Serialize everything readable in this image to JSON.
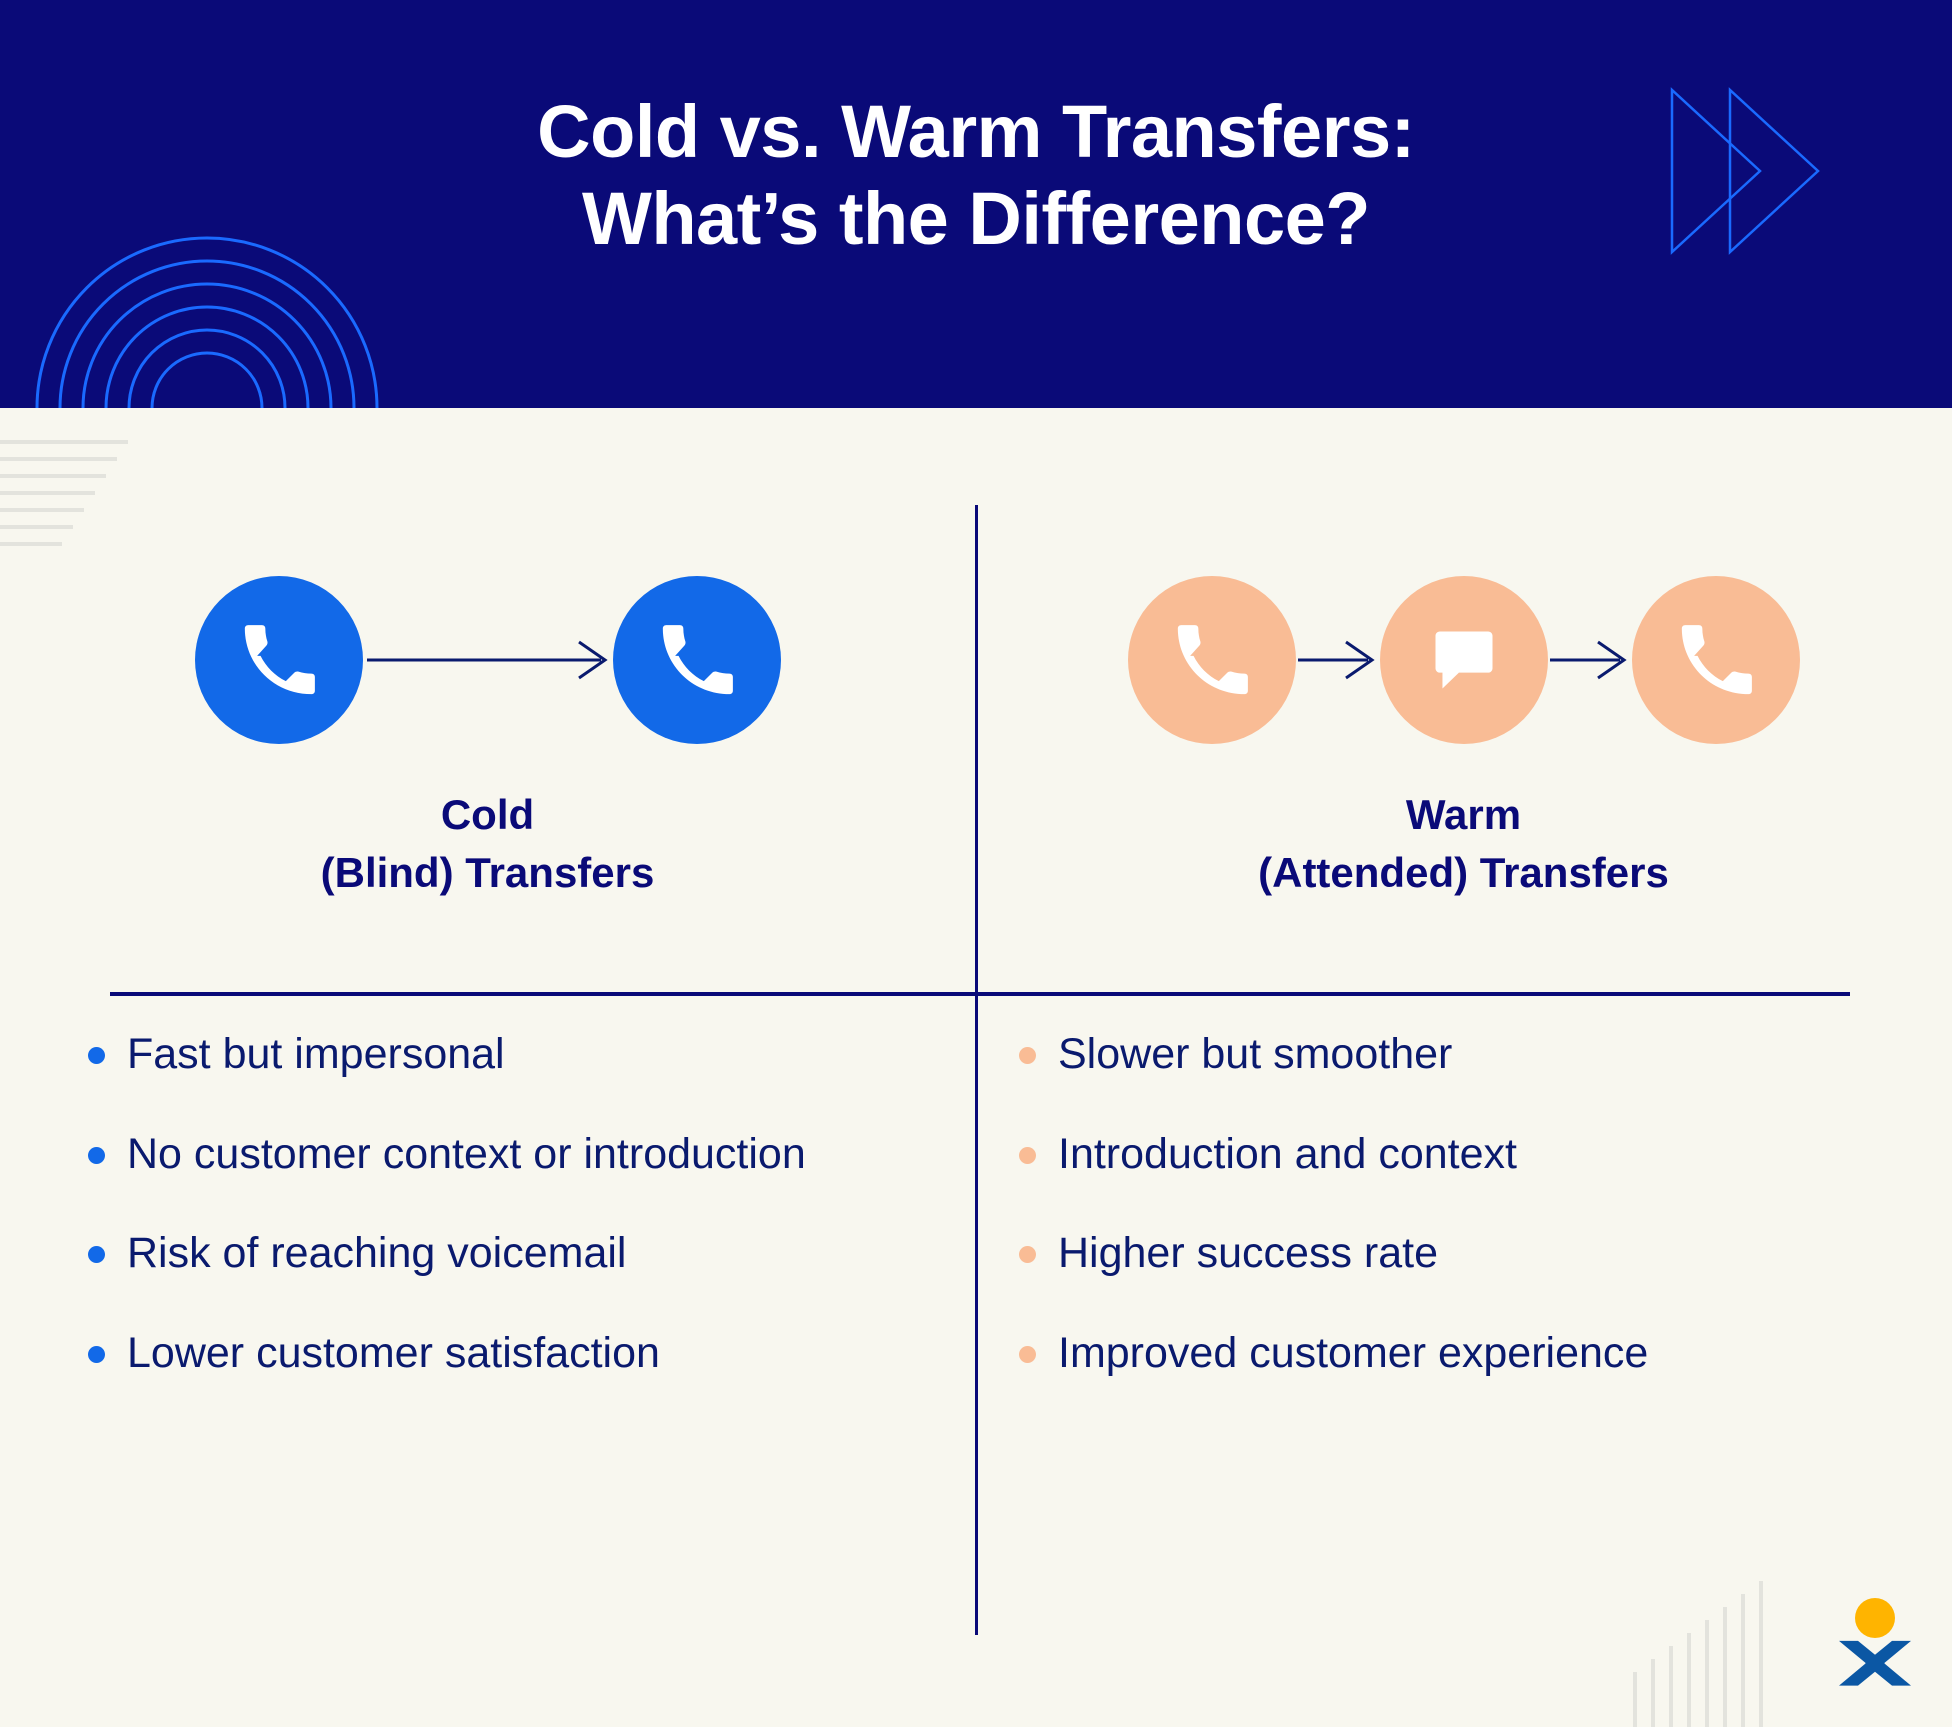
{
  "header": {
    "title_line1": "Cold vs. Warm Transfers:",
    "title_line2": "What’s the Difference?",
    "background_color": "#0a0a78",
    "text_color": "#ffffff",
    "arc_color": "#1a6aff",
    "chevron_icon": "double-chevron-right-icon",
    "arcs_icon": "concentric-arcs-icon"
  },
  "page": {
    "background_color": "#f8f7ef",
    "decor_line_color": "#e3e3dd",
    "divider_color": "#0a0a78"
  },
  "columns": [
    {
      "id": "cold",
      "heading_line1": "Cold",
      "heading_line2": "(Blind) Transfers",
      "accent_color": "#1269e8",
      "icon_flow": [
        {
          "name": "phone-icon",
          "glyph": "phone"
        },
        {
          "name": "arrow-right-icon",
          "glyph": "arrow"
        },
        {
          "name": "phone-icon",
          "glyph": "phone"
        }
      ],
      "bullets": [
        "Fast but impersonal",
        "No customer context or introduction",
        "Risk of reaching voicemail",
        "Lower customer satisfaction"
      ]
    },
    {
      "id": "warm",
      "heading_line1": "Warm",
      "heading_line2": "(Attended) Transfers",
      "accent_color": "#f9bc95",
      "icon_flow": [
        {
          "name": "phone-icon",
          "glyph": "phone"
        },
        {
          "name": "arrow-right-icon",
          "glyph": "arrow"
        },
        {
          "name": "chat-bubble-icon",
          "glyph": "chat"
        },
        {
          "name": "arrow-right-icon",
          "glyph": "arrow"
        },
        {
          "name": "phone-icon",
          "glyph": "phone"
        }
      ],
      "bullets": [
        "Slower but smoother",
        "Introduction and context",
        "Higher success rate",
        "Improved customer experience"
      ]
    }
  ],
  "logo": {
    "name": "nextiva-logo",
    "dot_color": "#ffb400",
    "mark_color": "#0b57a4"
  }
}
